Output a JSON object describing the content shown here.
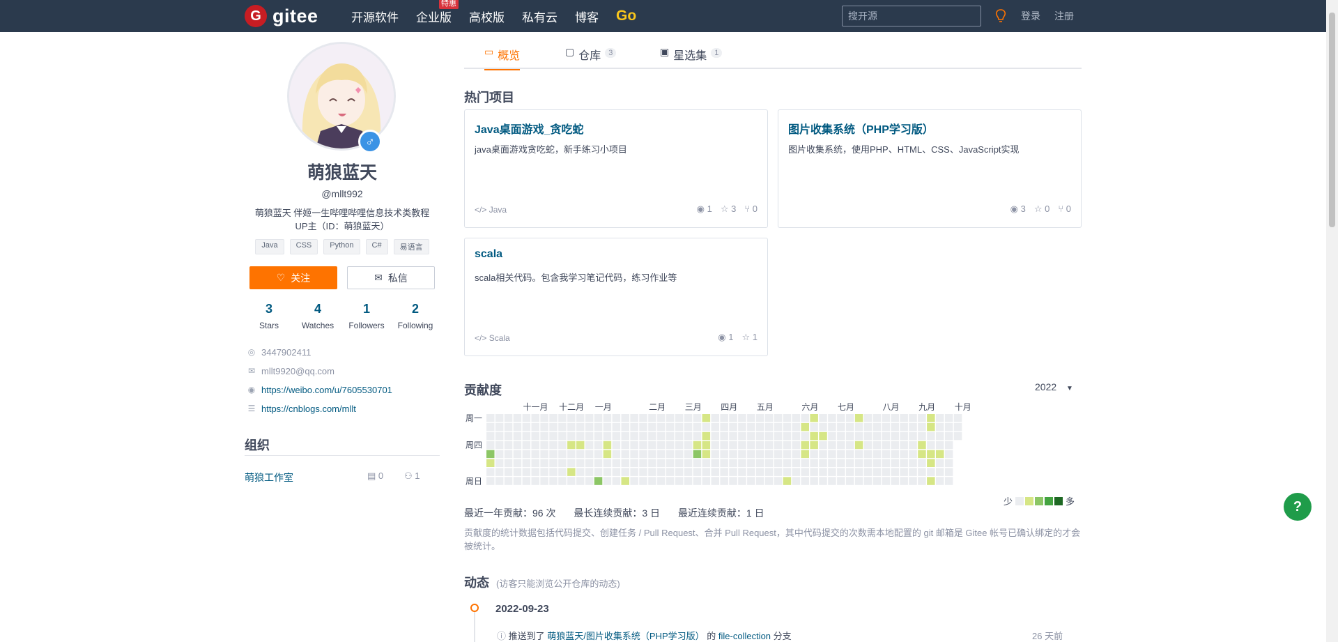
{
  "nav": {
    "logo_text": "gitee",
    "links": [
      {
        "label": "开源软件"
      },
      {
        "label": "企业版",
        "badge": "特惠"
      },
      {
        "label": "高校版"
      },
      {
        "label": "私有云"
      },
      {
        "label": "博客"
      },
      {
        "label": "Go"
      }
    ],
    "search_placeholder": "搜开源",
    "login": "登录",
    "register": "注册"
  },
  "profile": {
    "name": "萌狼蓝天",
    "handle": "@mllt992",
    "bio_line1": "萌狼蓝天 伴姬一生哔哩哔哩信息技术类教程",
    "bio_line2": "UP主（ID：萌狼蓝天）",
    "languages": [
      "Java",
      "CSS",
      "Python",
      "C#",
      "易语言"
    ],
    "follow_label": "关注",
    "message_label": "私信",
    "stats": [
      {
        "num": "3",
        "label": "Stars"
      },
      {
        "num": "4",
        "label": "Watches"
      },
      {
        "num": "1",
        "label": "Followers"
      },
      {
        "num": "2",
        "label": "Following"
      }
    ],
    "qq": "3447902411",
    "email": "mllt9920@qq.com",
    "weibo": "https://weibo.com/u/7605530701",
    "blog": "https://cnblogs.com/mllt"
  },
  "org": {
    "title": "组织",
    "name": "萌狼工作室",
    "repos": "0",
    "members": "1"
  },
  "tabs": [
    {
      "label": "概览",
      "count": ""
    },
    {
      "label": "仓库",
      "count": "3"
    },
    {
      "label": "星选集",
      "count": "1"
    }
  ],
  "hot_title": "热门项目",
  "projects": [
    {
      "title": "Java桌面游戏_贪吃蛇",
      "desc": "java桌面游戏贪吃蛇，新手练习小项目",
      "lang": "Java",
      "watch": "1",
      "star": "3",
      "fork": "0"
    },
    {
      "title": "图片收集系统（PHP学习版）",
      "desc": "图片收集系统，使用PHP、HTML、CSS、JavaScript实现",
      "lang": "",
      "watch": "3",
      "star": "0",
      "fork": "0"
    },
    {
      "title": "scala",
      "desc": "scala相关代码。包含我学习笔记代码，练习作业等",
      "lang": "Scala",
      "watch": "1",
      "star": "1",
      "fork": ""
    }
  ],
  "contribution": {
    "title": "贡献度",
    "year": "2022",
    "months": [
      "十一月",
      "十二月",
      "一月",
      "二月",
      "三月",
      "四月",
      "五月",
      "六月",
      "七月",
      "八月",
      "九月",
      "十月"
    ],
    "day_labels": [
      "周一",
      "周四",
      "周日"
    ],
    "legend_less": "少",
    "legend_more": "多",
    "stat_year": "最近一年贡献：96 次",
    "stat_longest": "最长连续贡献：3 日",
    "stat_recent": "最近连续贡献：1 日",
    "note": "贡献度的统计数据包括代码提交、创建任务 / Pull Request、合并 Pull Request，其中代码提交的次数需本地配置的 git 邮箱是 Gitee 帐号已确认绑定的才会被统计。",
    "colors": [
      "#ebedf0",
      "#d6e685",
      "#8cc665",
      "#44a340",
      "#1e6823"
    ],
    "cells": [
      [
        0,
        5,
        1
      ],
      [
        0,
        4,
        2
      ],
      [
        9,
        3,
        1
      ],
      [
        9,
        6,
        1
      ],
      [
        10,
        3,
        1
      ],
      [
        12,
        7,
        2
      ],
      [
        13,
        3,
        1
      ],
      [
        13,
        4,
        1
      ],
      [
        15,
        7,
        1
      ],
      [
        23,
        3,
        1
      ],
      [
        23,
        4,
        2
      ],
      [
        24,
        0,
        1
      ],
      [
        24,
        2,
        1
      ],
      [
        24,
        3,
        1
      ],
      [
        24,
        4,
        1
      ],
      [
        33,
        7,
        1
      ],
      [
        35,
        1,
        1
      ],
      [
        35,
        3,
        1
      ],
      [
        35,
        4,
        1
      ],
      [
        36,
        0,
        1
      ],
      [
        36,
        2,
        1
      ],
      [
        36,
        3,
        1
      ],
      [
        37,
        2,
        1
      ],
      [
        41,
        0,
        1
      ],
      [
        41,
        3,
        1
      ],
      [
        48,
        3,
        1
      ],
      [
        48,
        4,
        1
      ],
      [
        49,
        0,
        1
      ],
      [
        49,
        1,
        1
      ],
      [
        49,
        4,
        1
      ],
      [
        49,
        5,
        1
      ],
      [
        49,
        7,
        1
      ],
      [
        50,
        4,
        1
      ]
    ]
  },
  "activity": {
    "title": "动态",
    "subtitle": "(访客只能浏览公开仓库的动态)",
    "date": "2022-09-23",
    "item_prefix": "推送到了",
    "item_repo": "萌狼蓝天/图片收集系统（PHP学习版）",
    "item_mid": "的",
    "item_branch": "file-collection",
    "item_suffix": "分支",
    "item_time": "26 天前"
  },
  "help_label": "?"
}
